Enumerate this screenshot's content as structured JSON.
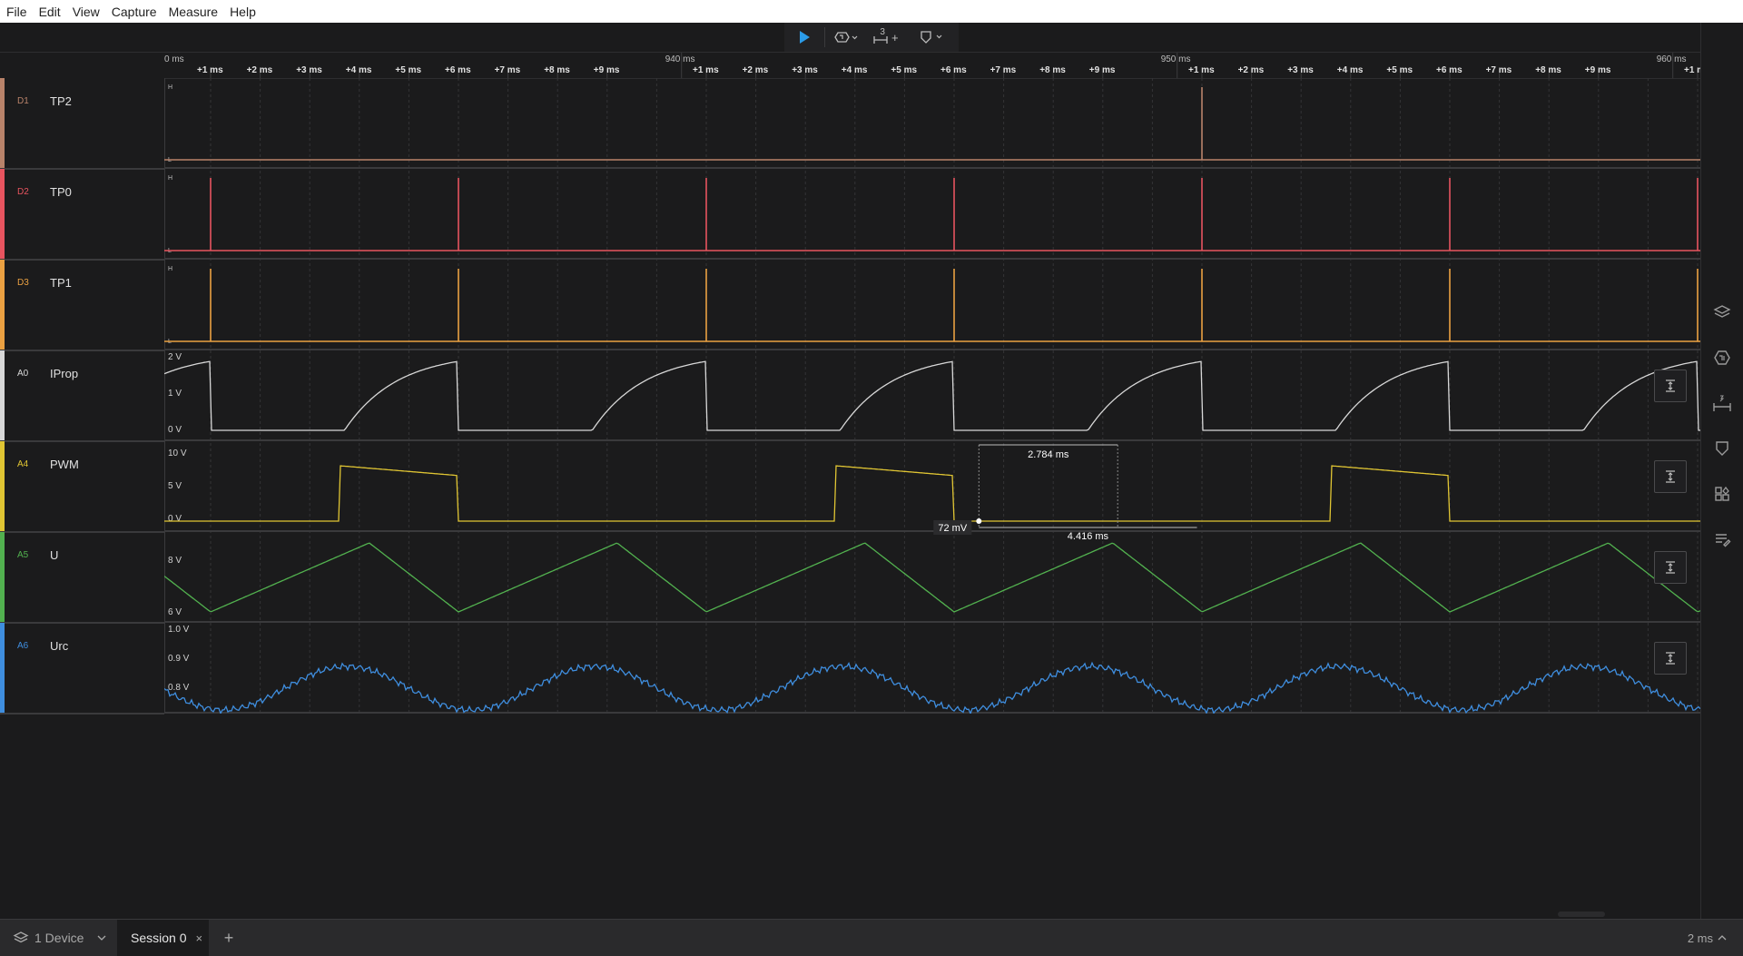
{
  "menu": [
    "File",
    "Edit",
    "View",
    "Capture",
    "Measure",
    "Help"
  ],
  "toolbar": {
    "timing_marker_count": "3",
    "timing_marker_add": "+"
  },
  "ruler": {
    "major": [
      {
        "t": -1,
        "label": "0 ms"
      },
      {
        "t": 9.5,
        "label": "940 ms"
      },
      {
        "t": 19.5,
        "label": "950 ms"
      },
      {
        "t": 29.5,
        "label": "960 ms"
      }
    ],
    "minor": [
      {
        "t": 0,
        "label": "+1 ms"
      },
      {
        "t": 1,
        "label": "+2 ms"
      },
      {
        "t": 2,
        "label": "+3 ms"
      },
      {
        "t": 3,
        "label": "+4 ms"
      },
      {
        "t": 4,
        "label": "+5 ms"
      },
      {
        "t": 5,
        "label": "+6 ms"
      },
      {
        "t": 6,
        "label": "+7 ms"
      },
      {
        "t": 7,
        "label": "+8 ms"
      },
      {
        "t": 8,
        "label": "+9 ms"
      },
      {
        "t": 10,
        "label": "+1 ms"
      },
      {
        "t": 11,
        "label": "+2 ms"
      },
      {
        "t": 12,
        "label": "+3 ms"
      },
      {
        "t": 13,
        "label": "+4 ms"
      },
      {
        "t": 14,
        "label": "+5 ms"
      },
      {
        "t": 15,
        "label": "+6 ms"
      },
      {
        "t": 16,
        "label": "+7 ms"
      },
      {
        "t": 17,
        "label": "+8 ms"
      },
      {
        "t": 18,
        "label": "+9 ms"
      },
      {
        "t": 20,
        "label": "+1 ms"
      },
      {
        "t": 21,
        "label": "+2 ms"
      },
      {
        "t": 22,
        "label": "+3 ms"
      },
      {
        "t": 23,
        "label": "+4 ms"
      },
      {
        "t": 24,
        "label": "+5 ms"
      },
      {
        "t": 25,
        "label": "+6 ms"
      },
      {
        "t": 26,
        "label": "+7 ms"
      },
      {
        "t": 27,
        "label": "+8 ms"
      },
      {
        "t": 28,
        "label": "+9 ms"
      },
      {
        "t": 30,
        "label": "+1 ms"
      }
    ]
  },
  "channels": [
    {
      "id": "D1",
      "name": "TP2",
      "color": "#b9836a",
      "kind": "digital",
      "hi": "H",
      "lo": "L",
      "pulses": [
        20
      ]
    },
    {
      "id": "D2",
      "name": "TP0",
      "color": "#e8545f",
      "kind": "digital",
      "hi": "H",
      "lo": "L",
      "pulses": [
        0,
        5,
        10,
        15,
        20,
        25,
        30
      ]
    },
    {
      "id": "D3",
      "name": "TP1",
      "color": "#eba142",
      "kind": "digital",
      "hi": "H",
      "lo": "L",
      "pulses": [
        0,
        5,
        10,
        15,
        20,
        25,
        30
      ]
    },
    {
      "id": "A0",
      "name": "IProp",
      "color": "#d8d8d8",
      "kind": "analog",
      "labels": [
        "2 V",
        "1 V",
        "0 V"
      ],
      "period_ms": 5,
      "phase_ms": 0
    },
    {
      "id": "A4",
      "name": "PWM",
      "color": "#e0c533",
      "kind": "analog",
      "labels": [
        "10 V",
        "5 V",
        "0 V"
      ],
      "period_ms": 10,
      "phase_ms": 0
    },
    {
      "id": "A5",
      "name": "U",
      "color": "#52b14f",
      "kind": "analog",
      "labels": [
        "8 V",
        "6 V"
      ],
      "period_ms": 5,
      "phase_ms": 0
    },
    {
      "id": "A6",
      "name": "Urc",
      "color": "#3f8edf",
      "kind": "analog",
      "labels": [
        "1.0 V",
        "0.9 V",
        "0.8 V"
      ],
      "period_ms": 5,
      "phase_ms": 0
    }
  ],
  "measurements": {
    "pulse_width": "2.784 ms",
    "period": "4.416 ms",
    "value": "72 mV"
  },
  "bottom": {
    "device": "1 Device",
    "session": "Session 0",
    "close": "×",
    "add": "+",
    "zoom": "2 ms"
  }
}
